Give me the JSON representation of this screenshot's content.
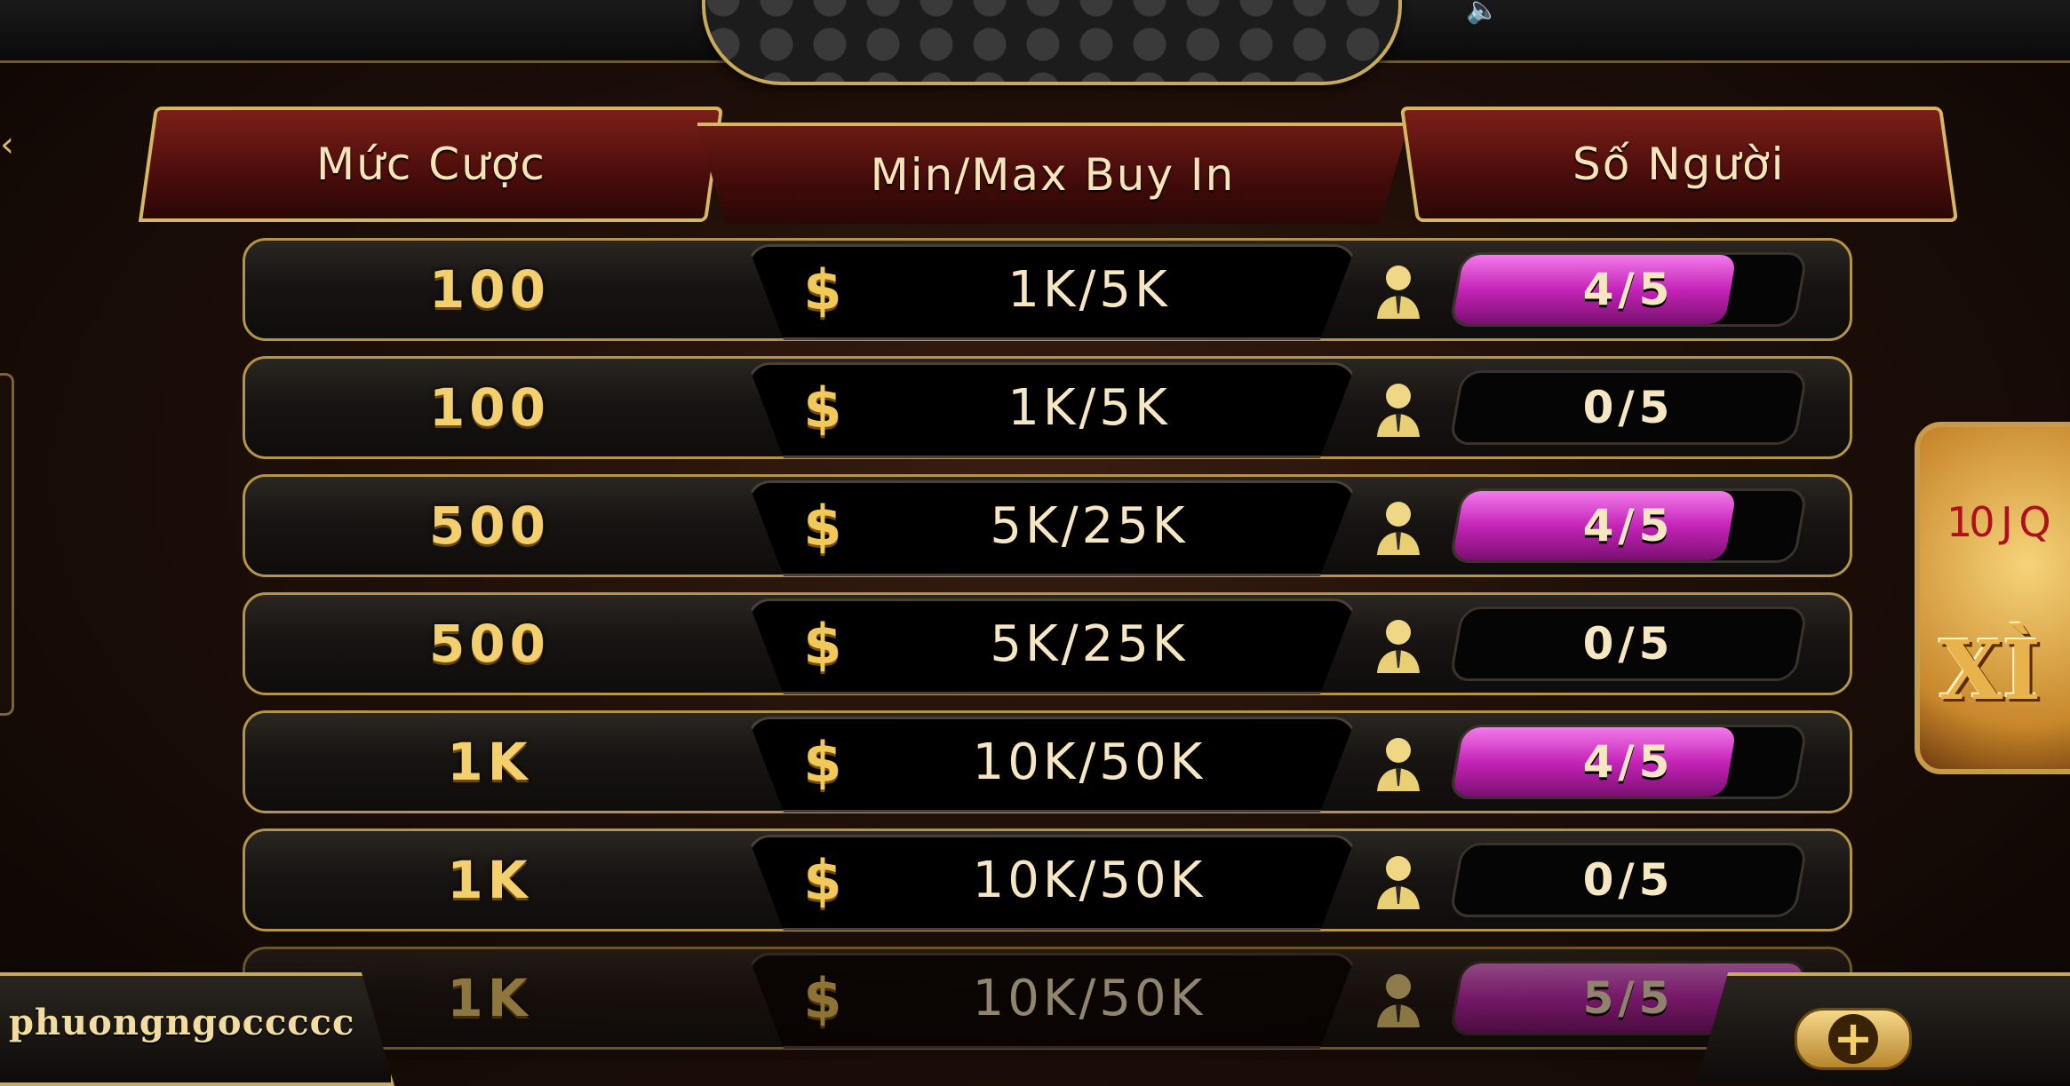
{
  "header": {
    "bet_label": "Mức Cược",
    "buyin_label": "Min/Max Buy In",
    "players_label": "Số Người"
  },
  "rows": [
    {
      "bet": "100",
      "buyin": "1K/5K",
      "players": "4/5",
      "fill": 0.8
    },
    {
      "bet": "100",
      "buyin": "1K/5K",
      "players": "0/5",
      "fill": 0
    },
    {
      "bet": "500",
      "buyin": "5K/25K",
      "players": "4/5",
      "fill": 0.8
    },
    {
      "bet": "500",
      "buyin": "5K/25K",
      "players": "0/5",
      "fill": 0
    },
    {
      "bet": "1K",
      "buyin": "10K/50K",
      "players": "4/5",
      "fill": 0.8
    },
    {
      "bet": "1K",
      "buyin": "10K/50K",
      "players": "0/5",
      "fill": 0
    },
    {
      "bet": "1K",
      "buyin": "10K/50K",
      "players": "5/5",
      "fill": 1
    }
  ],
  "icons": {
    "currency": "$",
    "player": "player-icon",
    "speaker": "speaker-icon",
    "add": "plus-icon"
  },
  "user": {
    "username": "phuongngoccccc"
  },
  "promo": {
    "title": "XÌ",
    "cards": "10 J Q"
  },
  "colors": {
    "gold": "#d7b764",
    "magenta": "#c524b8",
    "maroon": "#5a1210"
  }
}
